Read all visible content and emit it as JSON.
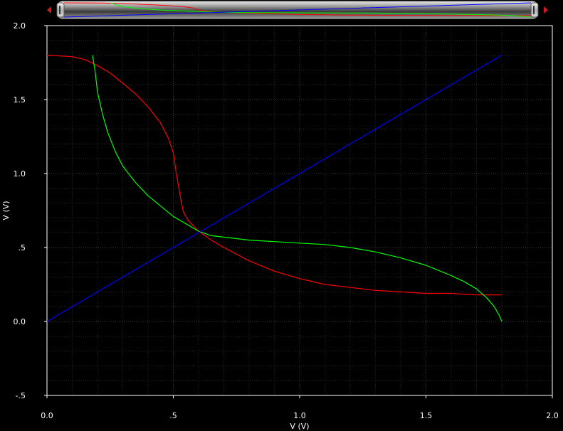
{
  "chart_data": {
    "type": "line",
    "xlabel": "V (V)",
    "ylabel": "V (V)",
    "xlim": [
      0,
      2.0
    ],
    "ylim": [
      -0.5,
      2.0
    ],
    "x_ticks": [
      "0.0",
      ".5",
      "1.0",
      "1.5",
      "2.0"
    ],
    "y_ticks": [
      "2.0",
      "1.5",
      "1.0",
      ".5",
      "0.0",
      "-.5"
    ],
    "grid": true,
    "background": "#000000",
    "axis_color": "#ffffff",
    "series": [
      {
        "color": "#ff0000",
        "points": [
          [
            0.0,
            1.8
          ],
          [
            0.1,
            1.79
          ],
          [
            0.15,
            1.77
          ],
          [
            0.2,
            1.73
          ],
          [
            0.25,
            1.68
          ],
          [
            0.3,
            1.61
          ],
          [
            0.35,
            1.54
          ],
          [
            0.4,
            1.45
          ],
          [
            0.45,
            1.34
          ],
          [
            0.48,
            1.24
          ],
          [
            0.5,
            1.14
          ],
          [
            0.51,
            1.02
          ],
          [
            0.52,
            0.92
          ],
          [
            0.53,
            0.82
          ],
          [
            0.54,
            0.74
          ],
          [
            0.56,
            0.68
          ],
          [
            0.6,
            0.61
          ],
          [
            0.65,
            0.55
          ],
          [
            0.7,
            0.5
          ],
          [
            0.8,
            0.41
          ],
          [
            0.9,
            0.34
          ],
          [
            1.0,
            0.29
          ],
          [
            1.1,
            0.25
          ],
          [
            1.2,
            0.23
          ],
          [
            1.3,
            0.21
          ],
          [
            1.4,
            0.2
          ],
          [
            1.5,
            0.19
          ],
          [
            1.6,
            0.19
          ],
          [
            1.7,
            0.18
          ],
          [
            1.8,
            0.18
          ]
        ]
      },
      {
        "color": "#00ff00",
        "points": [
          [
            0.18,
            1.8
          ],
          [
            0.19,
            1.7
          ],
          [
            0.2,
            1.55
          ],
          [
            0.22,
            1.4
          ],
          [
            0.24,
            1.28
          ],
          [
            0.27,
            1.15
          ],
          [
            0.3,
            1.05
          ],
          [
            0.35,
            0.94
          ],
          [
            0.4,
            0.85
          ],
          [
            0.45,
            0.78
          ],
          [
            0.5,
            0.71
          ],
          [
            0.55,
            0.66
          ],
          [
            0.6,
            0.61
          ],
          [
            0.65,
            0.58
          ],
          [
            0.7,
            0.57
          ],
          [
            0.8,
            0.55
          ],
          [
            0.9,
            0.54
          ],
          [
            1.0,
            0.53
          ],
          [
            1.1,
            0.52
          ],
          [
            1.2,
            0.5
          ],
          [
            1.3,
            0.47
          ],
          [
            1.4,
            0.43
          ],
          [
            1.5,
            0.38
          ],
          [
            1.6,
            0.31
          ],
          [
            1.65,
            0.27
          ],
          [
            1.7,
            0.22
          ],
          [
            1.74,
            0.16
          ],
          [
            1.77,
            0.1
          ],
          [
            1.79,
            0.04
          ],
          [
            1.8,
            0.0
          ]
        ]
      },
      {
        "color": "#0000ff",
        "points": [
          [
            0.0,
            0.0
          ],
          [
            1.8,
            1.8
          ]
        ]
      }
    ]
  },
  "scrubber": {
    "left_arrow_color": "#cc2020",
    "right_arrow_color": "#cc2020"
  }
}
